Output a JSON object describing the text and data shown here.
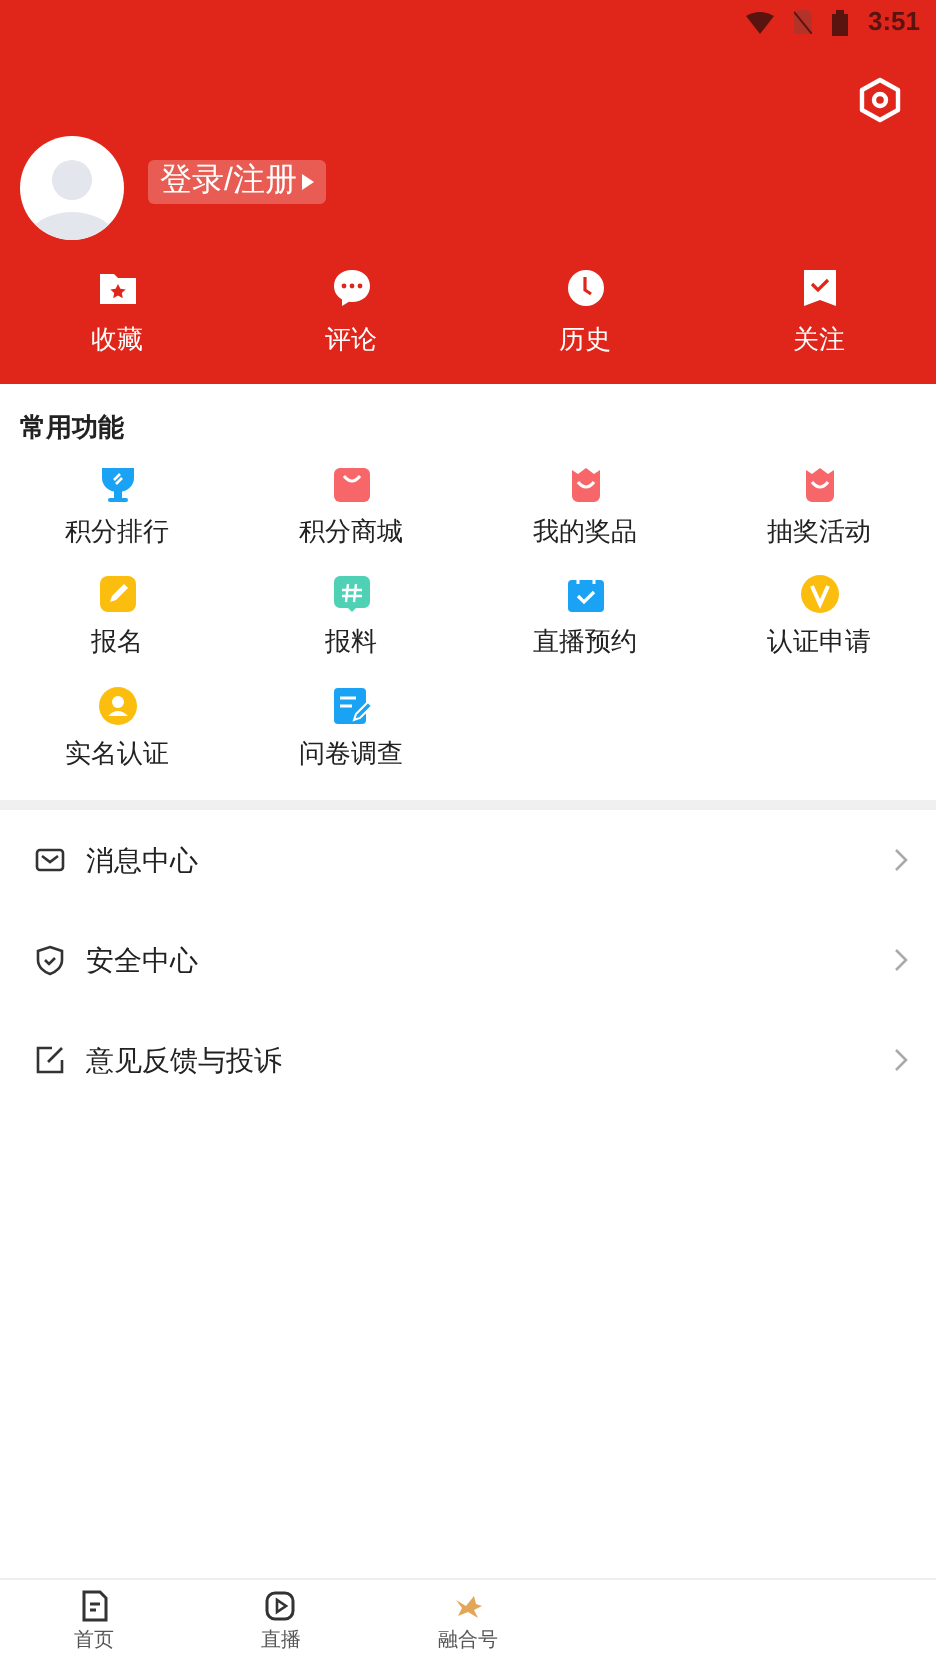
{
  "status_bar": {
    "time": "3:51"
  },
  "profile": {
    "login_label": "登录/注册"
  },
  "shortcuts": [
    {
      "label": "收藏"
    },
    {
      "label": "评论"
    },
    {
      "label": "历史"
    },
    {
      "label": "关注"
    }
  ],
  "common_functions": {
    "title": "常用功能",
    "items": [
      {
        "label": "积分排行"
      },
      {
        "label": "积分商城"
      },
      {
        "label": "我的奖品"
      },
      {
        "label": "抽奖活动"
      },
      {
        "label": "报名"
      },
      {
        "label": "报料"
      },
      {
        "label": "直播预约"
      },
      {
        "label": "认证申请"
      },
      {
        "label": "实名认证"
      },
      {
        "label": "问卷调查"
      }
    ]
  },
  "menu": [
    {
      "label": "消息中心"
    },
    {
      "label": "安全中心"
    },
    {
      "label": "意见反馈与投诉"
    }
  ],
  "bottom_nav": [
    {
      "label": "首页",
      "selected": false
    },
    {
      "label": "直播",
      "selected": false
    },
    {
      "label": "融合号",
      "selected": false
    }
  ]
}
